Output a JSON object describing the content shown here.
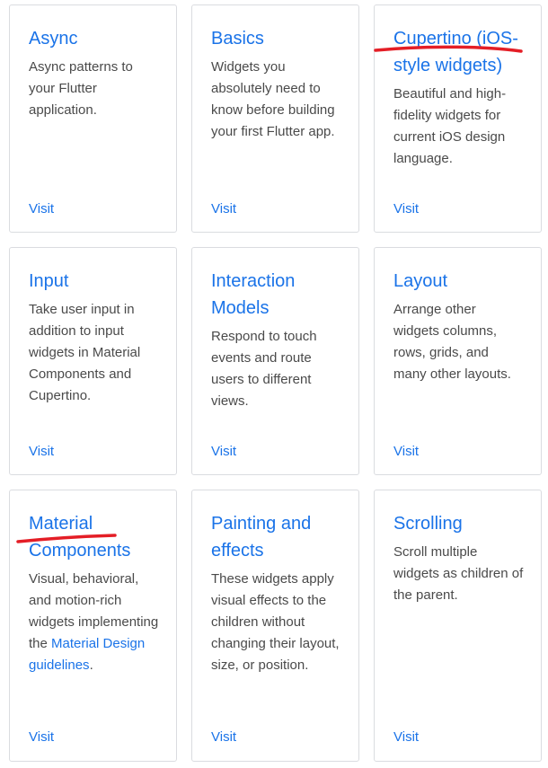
{
  "cards": [
    {
      "title": "Async",
      "description": "Async patterns to your Flutter application.",
      "visit_label": "Visit"
    },
    {
      "title": "Basics",
      "description": "Widgets you absolutely need to know before building your first Flutter app.",
      "visit_label": "Visit"
    },
    {
      "title": "Cupertino (iOS-style widgets)",
      "description": "Beautiful and high-fidelity widgets for current iOS design language.",
      "visit_label": "Visit"
    },
    {
      "title": "Input",
      "description": "Take user input in addition to input widgets in Material Components and Cupertino.",
      "visit_label": "Visit"
    },
    {
      "title": "Interaction Models",
      "description": "Respond to touch events and route users to different views.",
      "visit_label": "Visit"
    },
    {
      "title": "Layout",
      "description": "Arrange other widgets columns, rows, grids, and many other layouts.",
      "visit_label": "Visit"
    },
    {
      "title": "Material Components",
      "description_prefix": "Visual, behavioral, and motion-rich widgets implementing the",
      "description_link": "Material Design guidelines",
      "description_suffix": ".",
      "visit_label": "Visit"
    },
    {
      "title": "Painting and effects",
      "description": "These widgets apply visual effects to the children without changing their layout, size, or position.",
      "visit_label": "Visit"
    },
    {
      "title": "Scrolling",
      "description": "Scroll multiple widgets as children of the parent.",
      "visit_label": "Visit"
    }
  ],
  "colors": {
    "link": "#1a73e8",
    "body_text": "#4a4a4a",
    "card_border": "#dadce0",
    "annotation": "#e41e26"
  }
}
